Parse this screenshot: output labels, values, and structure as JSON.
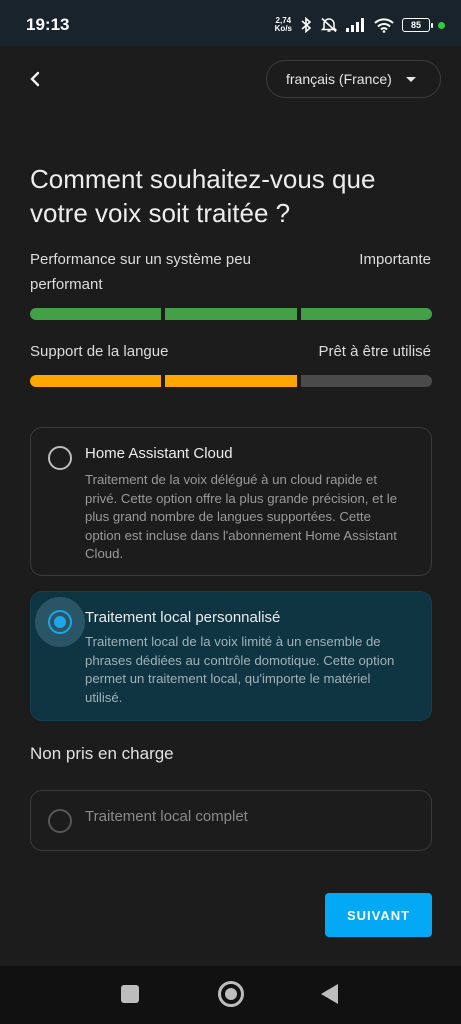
{
  "status_bar": {
    "time": "19:13",
    "net_speed_value": "2,74",
    "net_speed_unit": "Ko/s",
    "battery": "85",
    "icons": [
      "bluetooth-icon",
      "mute-icon",
      "signal-icon",
      "wifi-icon",
      "battery-icon"
    ]
  },
  "header": {
    "language_select": "français (France)"
  },
  "title": "Comment souhaitez-vous que votre voix soit traitée ?",
  "metrics": [
    {
      "label": "Performance sur un système peu performant",
      "value_label": "Importante",
      "level": 3,
      "max": 3,
      "color": "#43a047"
    },
    {
      "label": "Support de la langue",
      "value_label": "Prêt à être utilisé",
      "level": 2,
      "max": 3,
      "color": "#ffa600"
    }
  ],
  "options": [
    {
      "title": "Home Assistant Cloud",
      "description": "Traitement de la voix délégué à un cloud rapide et privé. Cette option offre la plus grande précision, et le plus grand nombre de langues supportées. Cette option est incluse dans l'abonnement Home Assistant Cloud.",
      "selected": false
    },
    {
      "title": "Traitement local personnalisé",
      "description": "Traitement local de la voix limité à un ensemble de phrases dédiées au contrôle domotique. Cette option permet un traitement local, qu'importe le matériel utilisé.",
      "selected": true
    }
  ],
  "unsupported": {
    "heading": "Non pris en charge",
    "options": [
      {
        "title": "Traitement local complet",
        "disabled": true
      }
    ]
  },
  "next_button": "SUIVANT",
  "colors": {
    "accent": "#03a9f4",
    "selected_card_bg": "#0f3442",
    "track": "#4a4a4a"
  }
}
